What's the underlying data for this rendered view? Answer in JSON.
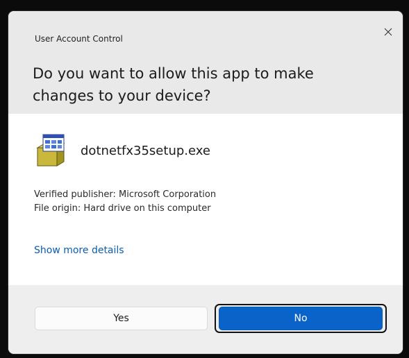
{
  "dialog": {
    "caption": "User Account Control",
    "question": "Do you want to allow this app to make changes to your device?",
    "close_icon": "close-icon"
  },
  "app": {
    "icon": "installer-icon",
    "name": "dotnetfx35setup.exe"
  },
  "info": {
    "publisher": "Verified publisher: Microsoft Corporation",
    "origin": "File origin: Hard drive on this computer"
  },
  "details_link": "Show more details",
  "buttons": {
    "yes_label": "Yes",
    "no_label": "No"
  },
  "colors": {
    "accent": "#0a63c9",
    "link": "#0a5db3",
    "header_bg": "#e9e9e9",
    "footer_bg": "#eeeeee"
  }
}
